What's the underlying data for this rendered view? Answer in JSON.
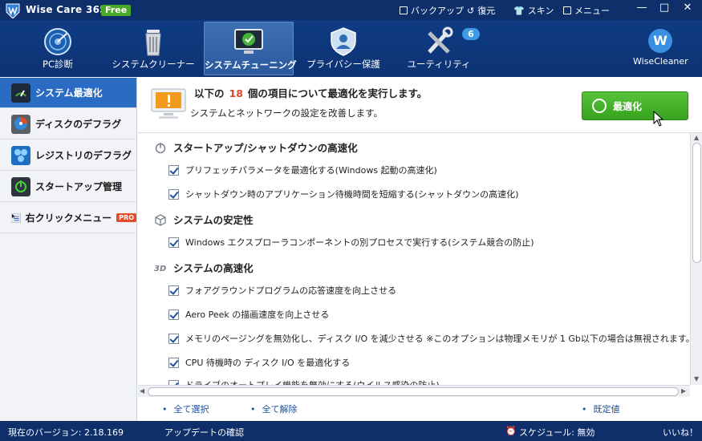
{
  "titlebar": {
    "app_title": "Wise Care 365",
    "free_badge": "Free",
    "backup": "バックアップ",
    "restore": "復元",
    "skin": "スキン",
    "menu": "メニュー",
    "minimize": "—",
    "maximize": "□",
    "close": "✕"
  },
  "nav": {
    "items": [
      {
        "label": "PC診断",
        "icon": "radar-icon"
      },
      {
        "label": "システムクリーナー",
        "icon": "trash-can-icon"
      },
      {
        "label": "システムチューニング",
        "icon": "monitor-tuning-icon"
      },
      {
        "label": "プライバシー保護",
        "icon": "shield-user-icon"
      },
      {
        "label": "ユーティリティ",
        "icon": "tools-icon"
      }
    ],
    "active_index": 2,
    "utility_badge": "6",
    "brand_letter": "W",
    "brand_label": "WiseCleaner"
  },
  "sidebar": {
    "items": [
      {
        "label": "システム最適化",
        "icon": "speed-icon"
      },
      {
        "label": "ディスクのデフラグ",
        "icon": "disk-icon"
      },
      {
        "label": "レジストリのデフラグ",
        "icon": "registry-icon"
      },
      {
        "label": "スタートアップ管理",
        "icon": "power-icon"
      },
      {
        "label": "右クリックメニュー",
        "icon": "context-menu-icon"
      }
    ],
    "pro_badge": "PRO",
    "active_index": 0
  },
  "info": {
    "line1_prefix": "以下の",
    "count": "18",
    "line1_suffix": "個の項目について最適化を実行します。",
    "line2": "システムとネットワークの設定を改善します。",
    "optimize_button": "最適化"
  },
  "list": {
    "sections": [
      {
        "title": "スタートアップ/シャットダウンの高速化",
        "icon": "power-icon"
      },
      {
        "title": "システムの安定性",
        "icon": "cube-icon"
      },
      {
        "title": "システムの高速化",
        "icon": "3d-icon"
      }
    ],
    "rows": [
      "プリフェッチパラメータを最適化する(Windows 起動の高速化)",
      "シャットダウン時のアプリケーション待機時間を短縮する(シャットダウンの高速化)",
      "Windows エクスプローラコンポーネントの別プロセスで実行する(システム競合の防止)",
      "フォアグラウンドプログラムの応答速度を向上させる",
      "Aero Peek の描画速度を向上させる",
      "メモリのページングを無効化し、ディスク I/O を減少させる ※このオプションは物理メモリが 1 Gb以下の場合は無視されます。(アプリケーシ",
      "CPU 待機時の ディスク I/O を最適化する",
      "ドライブのオートプレイ機能を無効にする(ウイルス感染の防止)"
    ]
  },
  "actions": {
    "select_all": "全て選択",
    "deselect_all": "全て解除",
    "default": "既定値"
  },
  "status": {
    "version": "現在のバージョン: 2.18.169",
    "update_check": "アップデートの確認",
    "schedule": "スケジュール: 無効",
    "like": "いいね！"
  },
  "colors": {
    "titlebar": "#0e2f6a",
    "header": "#0f3c85",
    "sidebar_active": "#2a6bc4",
    "optimize_green": "#4ab42c",
    "count_red": "#e0452b"
  }
}
